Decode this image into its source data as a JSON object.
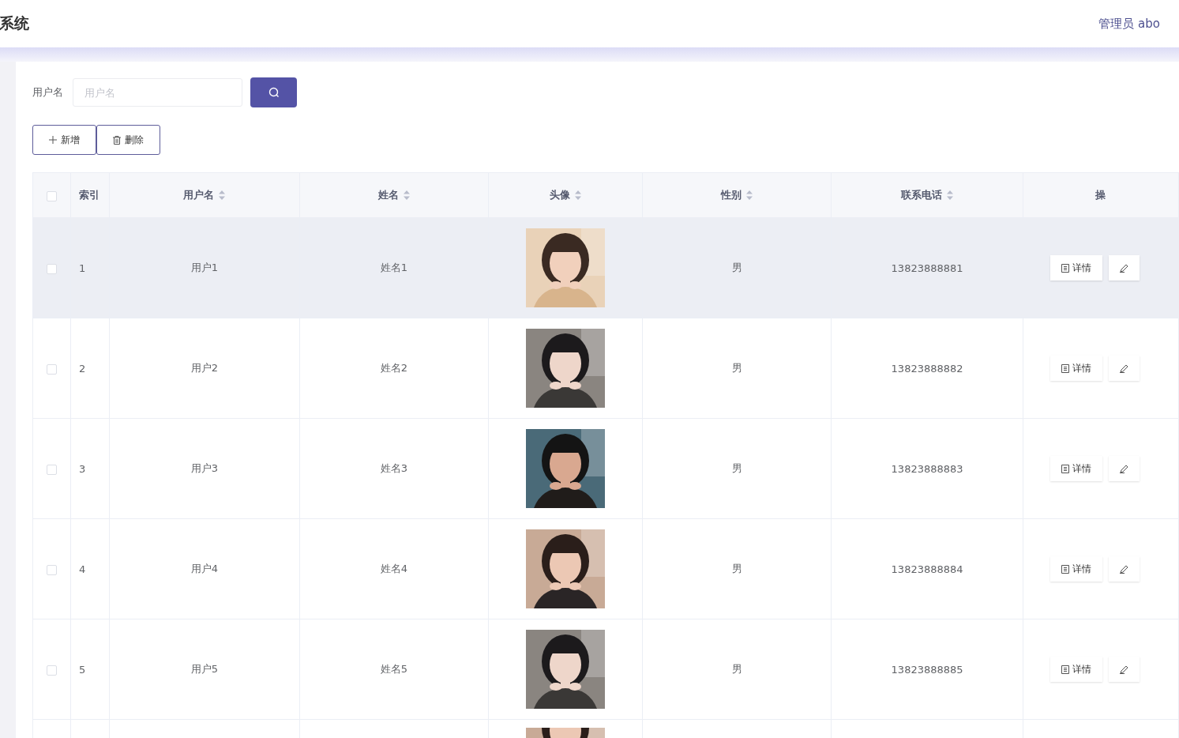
{
  "header": {
    "title": "系统",
    "user": "管理员 abo"
  },
  "search": {
    "label": "用户名",
    "placeholder": "用户名"
  },
  "toolbar": [
    {
      "kind": "add",
      "label": "新增"
    },
    {
      "kind": "delete",
      "label": "删除"
    }
  ],
  "table": {
    "select_all_checked": false,
    "columns": [
      {
        "kind": "check"
      },
      {
        "kind": "plain",
        "label": "索引"
      },
      {
        "kind": "sortable",
        "label": "用户名"
      },
      {
        "kind": "sortable",
        "label": "姓名"
      },
      {
        "kind": "sortable",
        "label": "头像"
      },
      {
        "kind": "sortable",
        "label": "性别"
      },
      {
        "kind": "sortable",
        "label": "联系电话"
      },
      {
        "kind": "plain",
        "label": "操"
      }
    ],
    "rows": [
      {
        "kind": "full",
        "checked": false,
        "hovered": true,
        "index": "1",
        "username": "用户1",
        "name": "姓名1",
        "gender": "男",
        "phone": "13823888881",
        "actions": [
          {
            "kind": "detail",
            "label": "详情"
          },
          {
            "kind": "edit"
          }
        ]
      },
      {
        "kind": "full",
        "checked": false,
        "hovered": false,
        "index": "2",
        "username": "用户2",
        "name": "姓名2",
        "gender": "男",
        "phone": "13823888882",
        "actions": [
          {
            "kind": "detail",
            "label": "详情"
          },
          {
            "kind": "edit"
          }
        ]
      },
      {
        "kind": "full",
        "checked": false,
        "hovered": false,
        "index": "3",
        "username": "用户3",
        "name": "姓名3",
        "gender": "男",
        "phone": "13823888883",
        "actions": [
          {
            "kind": "detail",
            "label": "详情"
          },
          {
            "kind": "edit"
          }
        ]
      },
      {
        "kind": "full",
        "checked": false,
        "hovered": false,
        "index": "4",
        "username": "用户4",
        "name": "姓名4",
        "gender": "男",
        "phone": "13823888884",
        "actions": [
          {
            "kind": "detail",
            "label": "详情"
          },
          {
            "kind": "edit"
          }
        ]
      },
      {
        "kind": "full",
        "checked": false,
        "hovered": false,
        "index": "5",
        "username": "用户5",
        "name": "姓名5",
        "gender": "男",
        "phone": "13823888885",
        "actions": [
          {
            "kind": "detail",
            "label": "详情"
          },
          {
            "kind": "edit"
          }
        ]
      },
      {
        "kind": "partial"
      }
    ]
  }
}
